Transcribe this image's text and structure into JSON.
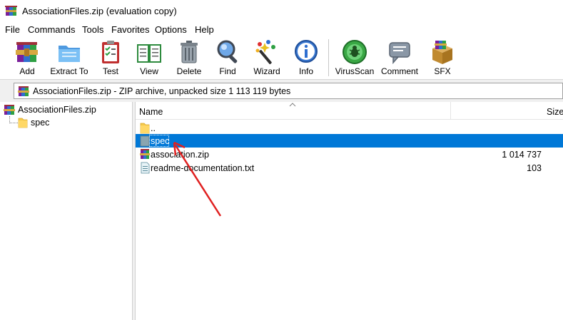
{
  "window": {
    "title": "AssociationFiles.zip (evaluation copy)"
  },
  "menu": [
    "File",
    "Commands",
    "Tools",
    "Favorites",
    "Options",
    "Help"
  ],
  "toolbar": {
    "buttons": [
      {
        "label": "Add",
        "icon": "add-archive-icon"
      },
      {
        "label": "Extract To",
        "icon": "extract-folder-icon"
      },
      {
        "label": "Test",
        "icon": "test-clipboard-icon"
      },
      {
        "label": "View",
        "icon": "view-book-icon"
      },
      {
        "label": "Delete",
        "icon": "trash-can-icon"
      },
      {
        "label": "Find",
        "icon": "magnifier-icon"
      },
      {
        "label": "Wizard",
        "icon": "magic-wand-icon"
      },
      {
        "label": "Info",
        "icon": "info-icon"
      },
      {
        "label": "VirusScan",
        "icon": "virus-scan-icon"
      },
      {
        "label": "Comment",
        "icon": "comment-icon"
      },
      {
        "label": "SFX",
        "icon": "sfx-box-icon"
      }
    ]
  },
  "address": {
    "text": "AssociationFiles.zip - ZIP archive, unpacked size 1 113 119 bytes"
  },
  "tree": {
    "root": "AssociationFiles.zip",
    "child": "spec"
  },
  "file_list": {
    "columns": {
      "name": "Name",
      "size": "Size"
    },
    "rows": [
      {
        "name": "..",
        "size": "",
        "icon": "folder-icon",
        "selected": false
      },
      {
        "name": "spec",
        "size": "",
        "icon": "folder-gray-icon",
        "selected": true
      },
      {
        "name": "association.zip",
        "size": "1 014 737",
        "icon": "zip-archive-icon",
        "selected": false
      },
      {
        "name": "readme-documentation.txt",
        "size": "103",
        "icon": "text-file-icon",
        "selected": false
      }
    ]
  },
  "colors": {
    "selection": "#0078d7",
    "annotation_arrow": "#e02020"
  }
}
